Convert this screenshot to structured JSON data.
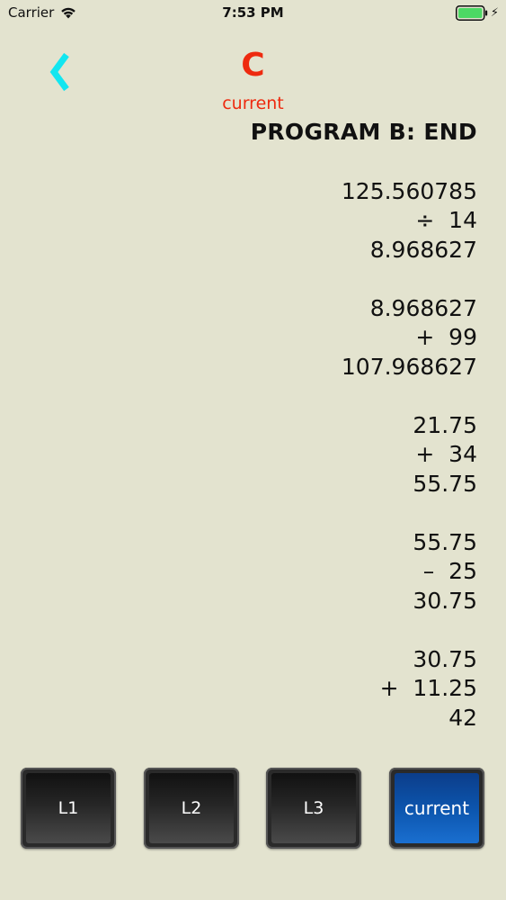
{
  "status_bar": {
    "carrier": "Carrier",
    "time": "7:53 PM"
  },
  "header": {
    "letter": "C",
    "subtitle": "current"
  },
  "log": {
    "title": "PROGRAM B: END",
    "groups": [
      [
        "125.560785",
        "÷  14",
        "8.968627"
      ],
      [
        "8.968627",
        "+  99",
        "107.968627"
      ],
      [
        "21.75",
        "+  34",
        "55.75"
      ],
      [
        "55.75",
        "–  25",
        "30.75"
      ],
      [
        "30.75",
        "+  11.25",
        "42"
      ]
    ]
  },
  "buttons": [
    {
      "label": "L1",
      "active": false
    },
    {
      "label": "L2",
      "active": false
    },
    {
      "label": "L3",
      "active": false
    },
    {
      "label": "current",
      "active": true
    }
  ],
  "colors": {
    "background": "#e3e3cf",
    "accent_red": "#ee2a0f",
    "back_cyan": "#12e6f0",
    "active_blue": "#0d57b0",
    "battery_green": "#4cd964"
  }
}
